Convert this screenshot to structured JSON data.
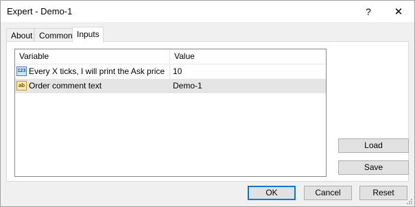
{
  "window": {
    "title": "Expert - Demo-1",
    "help_label": "?",
    "close_label": "✕"
  },
  "tabs": [
    {
      "label": "About",
      "active": false
    },
    {
      "label": "Common",
      "active": false
    },
    {
      "label": "Inputs",
      "active": true
    }
  ],
  "grid": {
    "columns": [
      "Variable",
      "Value"
    ],
    "rows": [
      {
        "icon": "integer-type-icon",
        "icon_text": "123",
        "variable": "Every X ticks, I will print the Ask price",
        "value": "10",
        "selected": false
      },
      {
        "icon": "string-type-icon",
        "icon_text": "ab",
        "variable": "Order comment text",
        "value": "Demo-1",
        "selected": true
      }
    ]
  },
  "side_buttons": {
    "load": "Load",
    "save": "Save"
  },
  "bottom_buttons": {
    "ok": "OK",
    "cancel": "Cancel",
    "reset": "Reset"
  }
}
